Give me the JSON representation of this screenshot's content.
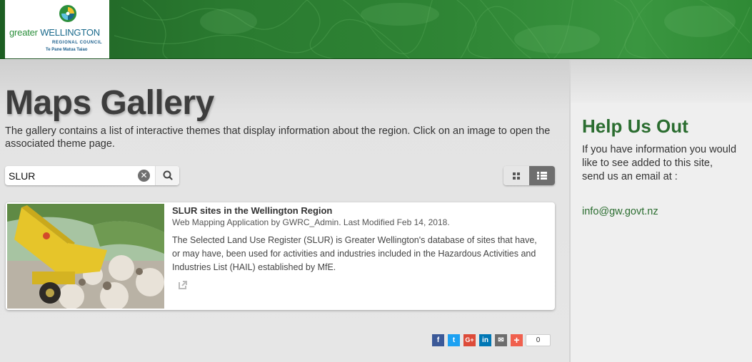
{
  "header": {
    "logo": {
      "name_part1": "greater",
      "name_part2": "WELLINGTON",
      "line2": "REGIONAL COUNCIL",
      "line3": "Te Pane Matua Taiao"
    }
  },
  "main": {
    "title": "Maps Gallery",
    "intro": "The gallery contains a list of interactive themes that display information about the region. Click on an image to open the associated theme page.",
    "search": {
      "value": "SLUR",
      "placeholder": ""
    },
    "items": [
      {
        "title": "SLUR sites in the Wellington Region",
        "meta": "Web Mapping Application by GWRC_Admin. Last Modified Feb 14, 2018.",
        "description": "The Selected Land Use Register (SLUR) is Greater Wellington's database of sites that have, or may have, been used for activities and industries included in the Hazardous Activities and Industries List (HAIL) established by MfE."
      }
    ],
    "share": {
      "facebook": "f",
      "twitter": "t",
      "google": "G+",
      "linkedin": "in",
      "email": "✉",
      "more": "+",
      "count": "0"
    }
  },
  "sidebar": {
    "title": "Help Us Out",
    "text": "If you have information you would like to see added to this site,",
    "text2": "send us an email at :",
    "email": "info@gw.govt.nz"
  },
  "colors": {
    "header_green": "#2f8535",
    "accent_green": "#2b6d30",
    "facebook": "#3b5998",
    "twitter": "#1da1f2",
    "google": "#dd4b39",
    "linkedin": "#0077b5",
    "email": "#6d6d6d",
    "more": "#f0604e"
  }
}
